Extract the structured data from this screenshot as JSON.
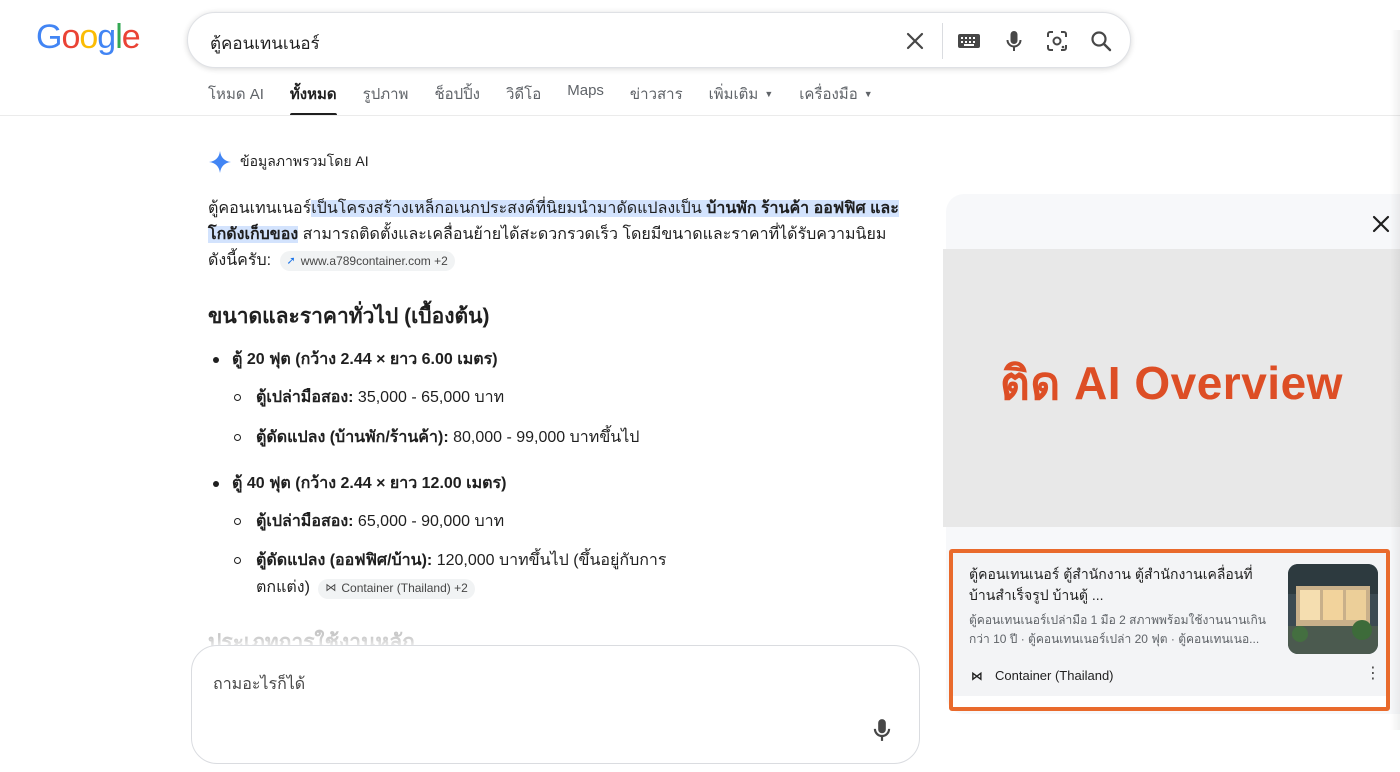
{
  "logo": {
    "G": "G",
    "o1": "o",
    "o2": "o",
    "g": "g",
    "l": "l",
    "e": "e"
  },
  "search": {
    "query": "ตู้คอนเทนเนอร์"
  },
  "tabs": [
    {
      "label": "โหมด AI"
    },
    {
      "label": "ทั้งหมด"
    },
    {
      "label": "รูปภาพ"
    },
    {
      "label": "ช็อปปิ้ง"
    },
    {
      "label": "วิดีโอ"
    },
    {
      "label": "Maps"
    },
    {
      "label": "ข่าวสาร"
    },
    {
      "label": "เพิ่มเติม"
    },
    {
      "label": "เครื่องมือ"
    }
  ],
  "ai_overview": {
    "header": "ข้อมูลภาพรวมโดย AI",
    "intro_plain1": "ตู้คอนเทนเนอร์",
    "intro_hl1": "เป็นโครงสร้างเหล็กอเนกประสงค์ที่นิยมนำมาดัดแปลงเป็น ",
    "intro_hl_bold": "บ้านพัก ร้านค้า ออฟฟิศ และโกดังเก็บของ",
    "intro_plain2": " สามารถติดตั้งและเคลื่อนย้ายได้สะดวกรวดเร็ว โดยมีขนาดและราคาที่ได้รับความนิยม ดังนี้ครับ:",
    "intro_chip": "www.a789container.com +2",
    "section_title": "ขนาดและราคาทั่วไป (เบื้องต้น)",
    "items": [
      {
        "title": "ตู้ 20 ฟุต (กว้าง 2.44 × ยาว 6.00 เมตร)",
        "subs": [
          {
            "label": "ตู้เปล่ามือสอง:",
            "value": " 35,000 - 65,000 บาท"
          },
          {
            "label": "ตู้ดัดแปลง (บ้านพัก/ร้านค้า):",
            "value": " 80,000 - 99,000 บาทขึ้นไป"
          }
        ]
      },
      {
        "title": "ตู้ 40 ฟุต (กว้าง 2.44 × ยาว 12.00 เมตร)",
        "subs": [
          {
            "label": "ตู้เปล่ามือสอง:",
            "value": " 65,000 - 90,000 บาท"
          },
          {
            "label": "ตู้ดัดแปลง (ออฟฟิศ/บ้าน):",
            "value": " 120,000 บาทขึ้นไป (ขึ้นอยู่กับการ",
            "value2": "ตกแต่ง)"
          }
        ]
      }
    ],
    "sub_chip": "Container (Thailand) +2",
    "faded_heading": "ประเภทการใช้งานหลัก"
  },
  "ask": {
    "placeholder": "ถามอะไรก็ได้"
  },
  "overlay": {
    "text": "ติด AI Overview"
  },
  "card": {
    "title": "ตู้คอนเทนเนอร์ ตู้สำนักงาน ตู้สำนักงานเคลื่อนที่ บ้านสำเร็จรูป บ้านตู้ ...",
    "snippet": "ตู้คอนเทนเนอร์เปล่ามือ 1 มือ 2 สภาพพร้อมใช้งานนานเกินกว่า 10 ปี · ตู้คอนเทนเนอร์เปล่า 20 ฟุต · ตู้คอนเทนเนอ...",
    "source": "Container (Thailand)"
  },
  "colors": {
    "accent_orange": "#e96a2c",
    "overlay_text": "#dd4e25",
    "highlight": "#d3e3fd"
  }
}
